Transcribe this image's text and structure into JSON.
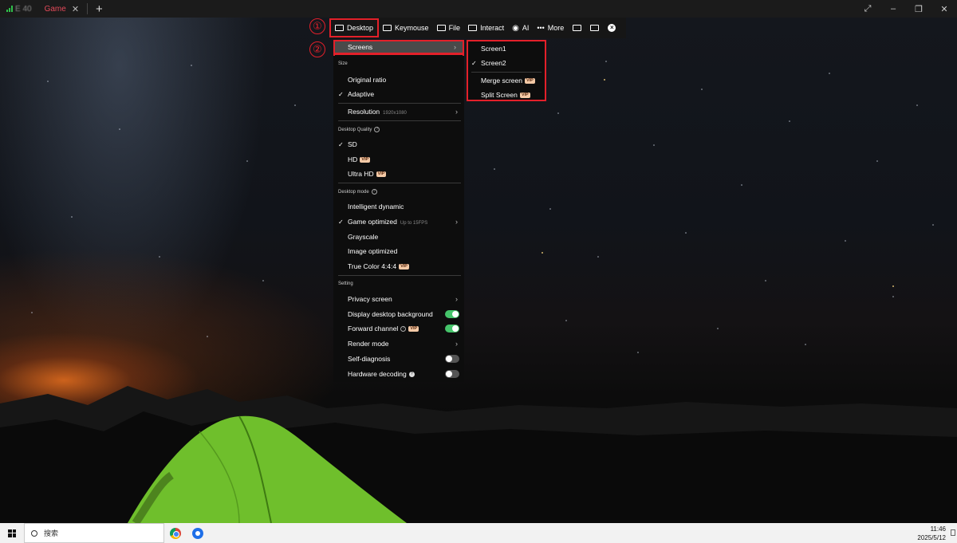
{
  "titlebar": {
    "tabs": [
      {
        "label": "E      40",
        "active": false
      },
      {
        "label": "Game",
        "active": true
      }
    ],
    "new_tab": "+",
    "controls": [
      "⤢",
      "–",
      "❐",
      "✕"
    ]
  },
  "toolbar": {
    "items": [
      {
        "label": "Desktop",
        "icon": "monitor-icon"
      },
      {
        "label": "Keymouse",
        "icon": "keyboard-icon"
      },
      {
        "label": "File",
        "icon": "folder-icon"
      },
      {
        "label": "Interact",
        "icon": "chat-icon"
      },
      {
        "label": "AI",
        "icon": "eye-icon"
      },
      {
        "label": "More",
        "icon": "ellipsis-icon"
      }
    ],
    "extra_icons": [
      "screen-icon",
      "screen-switch-icon",
      "close-circle-icon"
    ]
  },
  "callouts": [
    "①",
    "②"
  ],
  "menu": {
    "screens": {
      "label": "Screens",
      "arrow": "›"
    },
    "size_header": "Size",
    "size_options": [
      {
        "label": "Original ratio",
        "checked": false
      },
      {
        "label": "Adaptive",
        "checked": true
      }
    ],
    "resolution": {
      "label": "Resolution",
      "value": "1920x1080",
      "arrow": "›"
    },
    "quality_header": "Desktop Quality",
    "quality_options": [
      {
        "label": "SD",
        "checked": true,
        "vip": false
      },
      {
        "label": "HD",
        "checked": false,
        "vip": true
      },
      {
        "label": "Ultra HD",
        "checked": false,
        "vip": true
      }
    ],
    "mode_header": "Desktop mode",
    "mode_options": [
      {
        "label": "Intelligent dynamic",
        "checked": false,
        "vip": false,
        "note": ""
      },
      {
        "label": "Game optimized",
        "checked": true,
        "vip": false,
        "note": "Up to 15FPS"
      },
      {
        "label": "Grayscale",
        "checked": false,
        "vip": false,
        "note": ""
      },
      {
        "label": "Image optimized",
        "checked": false,
        "vip": false,
        "note": ""
      },
      {
        "label": "True Color 4:4:4",
        "checked": false,
        "vip": true,
        "note": ""
      }
    ],
    "setting_header": "Setting",
    "settings": [
      {
        "label": "Privacy screen",
        "type": "arrow"
      },
      {
        "label": "Display desktop background",
        "type": "toggle",
        "on": true
      },
      {
        "label": "Forward channel",
        "type": "toggle",
        "on": true
      },
      {
        "label": "Render mode",
        "type": "arrow"
      },
      {
        "label": "Self-diagnosis",
        "type": "toggle",
        "on": false
      },
      {
        "label": "Hardware decoding",
        "type": "toggle",
        "on": false
      }
    ],
    "vip_label": "VIP",
    "check": "✓"
  },
  "submenu": {
    "items": [
      {
        "label": "Screen1",
        "checked": false,
        "vip": false
      },
      {
        "label": "Screen2",
        "checked": true,
        "vip": false
      },
      {
        "label": "Merge screen",
        "checked": false,
        "vip": true
      },
      {
        "label": "Split Screen",
        "checked": false,
        "vip": true
      }
    ]
  },
  "taskbar": {
    "search_placeholder": "搜索",
    "time": "11:46",
    "date": "2025/5/12"
  }
}
